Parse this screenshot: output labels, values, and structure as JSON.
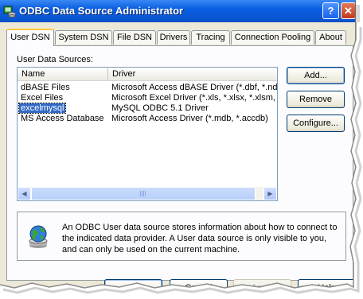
{
  "window": {
    "title": "ODBC Data Source Administrator",
    "help_button": "?",
    "close_button": "✕"
  },
  "tabs": [
    {
      "label": "User DSN",
      "active": true
    },
    {
      "label": "System DSN"
    },
    {
      "label": "File DSN"
    },
    {
      "label": "Drivers"
    },
    {
      "label": "Tracing"
    },
    {
      "label": "Connection Pooling"
    },
    {
      "label": "About"
    }
  ],
  "user_dsn": {
    "list_label": "User Data Sources:",
    "columns": [
      "Name",
      "Driver"
    ],
    "rows": [
      {
        "name": "dBASE Files",
        "driver": "Microsoft Access dBASE Driver (*.dbf, *.ndx"
      },
      {
        "name": "Excel Files",
        "driver": "Microsoft Excel Driver (*.xls, *.xlsx, *.xlsm, *.x"
      },
      {
        "name": "excelmysql",
        "driver": "MySQL ODBC 5.1 Driver",
        "selected": true
      },
      {
        "name": "MS Access Database",
        "driver": "Microsoft Access Driver (*.mdb, *.accdb)"
      }
    ],
    "scroll_left": "◀",
    "scroll_right": "▶",
    "buttons": {
      "add": "Add...",
      "remove": "Remove",
      "configure": "Configure..."
    },
    "info_text": "An ODBC User data source stores information about how to connect to the indicated data provider.   A User data source is only visible to you, and can only be used on the current machine."
  },
  "footer_buttons": {
    "ok": "OK",
    "cancel": "Cancel",
    "apply": "Apply",
    "help": "Help"
  },
  "colors": {
    "titlebar": "#0a5fe1",
    "selection": "#316ac5",
    "dialog": "#ece9d8",
    "tab_accent": "#ffc83c"
  },
  "icons": {
    "app": "odbc-app-icon",
    "info": "globe-database-icon"
  }
}
